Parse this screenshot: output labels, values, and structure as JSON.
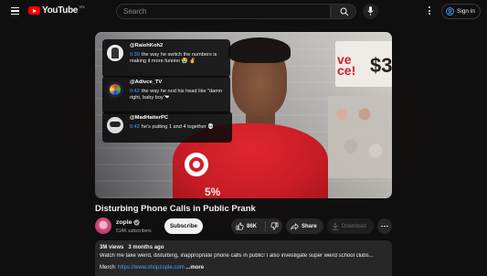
{
  "header": {
    "logo_text": "YouTube",
    "logo_region": "VN",
    "search_placeholder": "Search",
    "sign_in_label": "Sign in"
  },
  "video": {
    "sign_text": "ve\nce!",
    "sign_price": "$3",
    "shirt_text": "5%"
  },
  "comments": [
    {
      "user": "@RaiohKoh2",
      "time": "0:39",
      "text": "the way he switch the numbers is making it more funnier 😭 ✌"
    },
    {
      "user": "@Adivce_TV",
      "time": "0:42",
      "text": "the way he nod his head like \"damn right, baby boy\"❤"
    },
    {
      "user": "@MadHatterPC",
      "time": "0:42",
      "text": "he's putting 1 and 4 together 💀"
    }
  ],
  "title": "Disturbing Phone Calls in Public Prank",
  "channel": {
    "name": "zople",
    "subscribers": "514K subscribers",
    "subscribe_label": "Subscribe"
  },
  "actions": {
    "likes": "86K",
    "share_label": "Share",
    "download_label": "Download"
  },
  "description": {
    "views": "3M views",
    "age": "3 months ago",
    "text": "Watch me take weird, disturbing, inappropriate phone calls in public! I also investigate super weird school clubs...",
    "merch_label": "Merch:",
    "merch_link": "https://www.shopzople.com",
    "more_label": "...more"
  },
  "colors": {
    "background": "#0f0f0f",
    "accent_red": "#ff0000",
    "link_blue": "#3ea6ff",
    "button_bg": "#272727"
  }
}
